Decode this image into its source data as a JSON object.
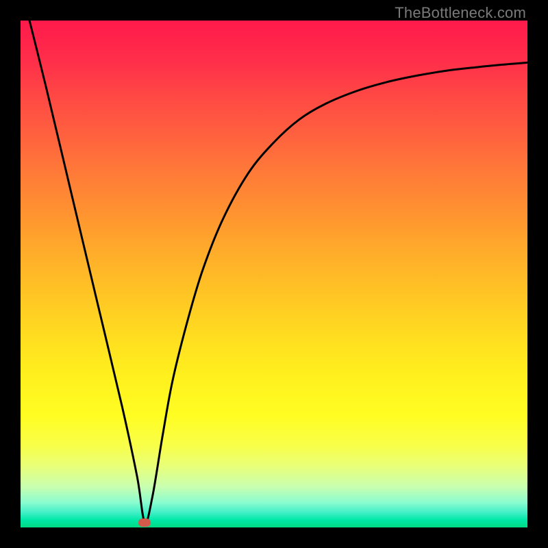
{
  "watermark": "TheBottleneck.com",
  "chart_data": {
    "type": "line",
    "title": "",
    "xlabel": "",
    "ylabel": "",
    "xlim": [
      0,
      100
    ],
    "ylim": [
      0,
      100
    ],
    "background": "vertical-rainbow-gradient",
    "series": [
      {
        "name": "bottleneck-curve",
        "x": [
          0,
          5,
          10,
          15,
          20,
          23,
          24.5,
          26,
          28,
          30,
          33,
          36,
          40,
          45,
          50,
          55,
          60,
          66,
          72,
          78,
          84,
          90,
          95,
          100
        ],
        "values": [
          107,
          87,
          66,
          45,
          24,
          10,
          1,
          6,
          18,
          29,
          41,
          51,
          61,
          70,
          76,
          80.5,
          83.5,
          86,
          87.8,
          89.1,
          90.1,
          90.8,
          91.3,
          91.7
        ]
      }
    ],
    "min_marker": {
      "x": 24.5,
      "y": 1,
      "color": "#d15a4a"
    },
    "gradient_stops": [
      {
        "pos": 0,
        "color": "#ff1a4b"
      },
      {
        "pos": 50,
        "color": "#ffc524"
      },
      {
        "pos": 80,
        "color": "#fffd22"
      },
      {
        "pos": 100,
        "color": "#00db84"
      }
    ]
  }
}
